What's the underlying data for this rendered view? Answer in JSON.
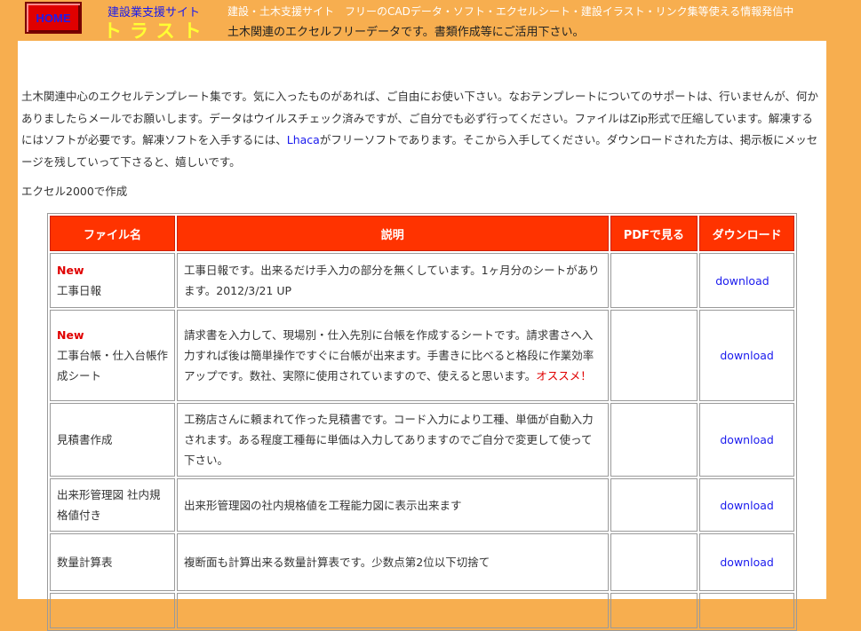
{
  "header": {
    "home_label": "HOME",
    "site_name": "建設業支援サイト",
    "site_logo": "トラスト",
    "tagline_1": "建設・土木支援サイト　フリーのCADデータ・ソフト・エクセルシート・建設イラスト・リンク集等使える情報発信中",
    "tagline_2": "土木関連のエクセルフリーデータです。書類作成等にご活用下さい。"
  },
  "intro": {
    "text_before_link": "土木関連中心のエクセルテンプレート集です。気に入ったものがあれば、ご自由にお使い下さい。なおテンプレートについてのサポートは、行いませんが、何かありましたらメールでお願いします。データはウイルスチェック済みですが、ご自分でも必ず行ってください。ファイルはZip形式で圧縮しています。解凍するにはソフトが必要です。解凍ソフトを入手するには、",
    "link_text": "Lhaca",
    "text_after_link": "がフリーソフトであります。そこから入手してください。ダウンロードされた方は、掲示板にメッセージを残していって下さると、嬉しいです。",
    "made_with": "エクセル2000で作成"
  },
  "table": {
    "headers": {
      "filename": "ファイル名",
      "description": "説明",
      "pdf": "PDFで見る",
      "download": "ダウンロード"
    },
    "rows": [
      {
        "new_badge": "New",
        "name": "工事日報",
        "description": "工事日報です。出来るだけ手入力の部分を無くしています。1ヶ月分のシートがあります。2012/3/21 UP",
        "recommend": "",
        "download": "download"
      },
      {
        "new_badge": "New",
        "name": "工事台帳・仕入台帳作成シート",
        "description": "請求書を入力して、現場別・仕入先別に台帳を作成するシートです。請求書さへ入力すれば後は簡単操作ですぐに台帳が出来ます。手書きに比べると格段に作業効率アップです。数社、実際に使用されていますので、使えると思います。",
        "recommend": "オススメ！",
        "download": "download"
      },
      {
        "new_badge": "",
        "name": "見積書作成",
        "description": "工務店さんに頼まれて作った見積書です。コード入力により工種、単価が自動入力されます。ある程度工種毎に単価は入力してありますのでご自分で変更して使って下さい。",
        "recommend": "",
        "download": "download"
      },
      {
        "new_badge": "",
        "name": "出来形管理図 社内規格値付き",
        "description": "出来形管理図の社内規格値を工程能力図に表示出来ます",
        "recommend": "",
        "download": "download"
      },
      {
        "new_badge": "",
        "name": "数量計算表",
        "description": "複断面も計算出来る数量計算表です。少数点第2位以下切捨て",
        "recommend": "",
        "download": "download"
      },
      {
        "new_badge": "",
        "name": "",
        "description": "",
        "recommend": "",
        "download": ""
      }
    ]
  },
  "colors": {
    "background_orange": "#f7ae4f",
    "header_red": "#ff3300",
    "link_blue": "#1a1aee",
    "logo_yellow": "#ffff33"
  }
}
